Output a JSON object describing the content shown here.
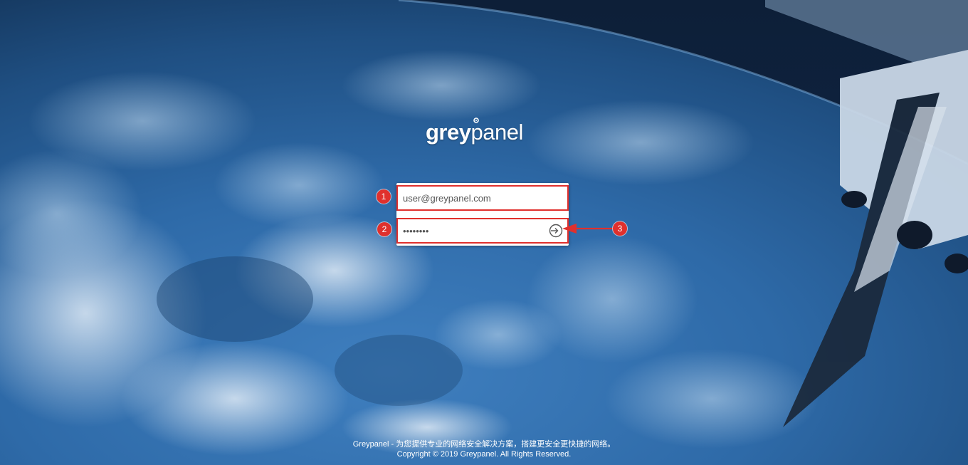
{
  "brand": {
    "logo_part1": "grey",
    "logo_part2": "panel",
    "name": "greypanel"
  },
  "login": {
    "username_value": "user@greypanel.com",
    "password_value": "password",
    "password_display": "•••••••••"
  },
  "annotations": {
    "marker1": "1",
    "marker2": "2",
    "marker3": "3",
    "color": "#e0302d"
  },
  "footer": {
    "line1": "Greypanel - 为您提供专业的网络安全解决方案，搭建更安全更快捷的网络。",
    "line2": "Copyright © 2019 Greypanel. All Rights Reserved."
  },
  "icons": {
    "submit": "login-arrow-icon",
    "logo_gear": "gear-icon"
  }
}
